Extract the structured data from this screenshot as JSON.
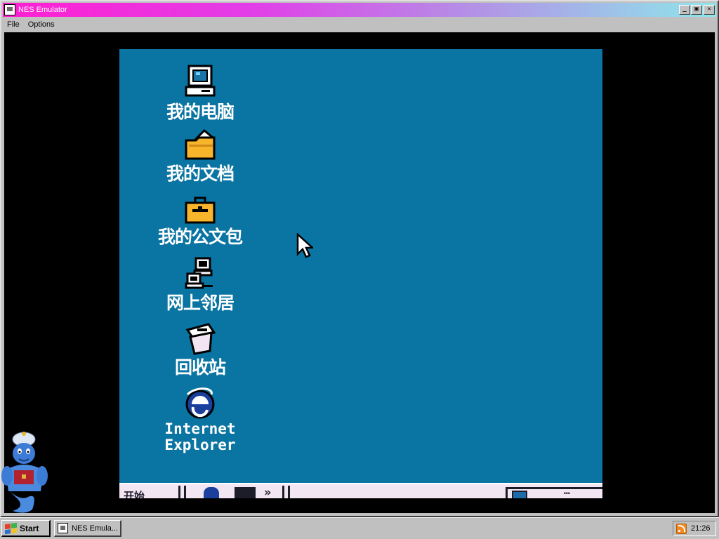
{
  "window": {
    "title": "NES Emulator",
    "buttons": [
      "minimize",
      "restore",
      "close"
    ]
  },
  "menu": [
    "File",
    "Options"
  ],
  "nes_desktop": {
    "background": "#0a74a2",
    "icons": [
      {
        "label": "我的电脑",
        "icon": "my-computer-icon"
      },
      {
        "label": "我的文档",
        "icon": "my-documents-icon"
      },
      {
        "label": "我的公文包",
        "icon": "briefcase-icon"
      },
      {
        "label": "网上邻居",
        "icon": "network-neighborhood-icon"
      },
      {
        "label": "回收站",
        "icon": "recycle-bin-icon"
      },
      {
        "label_line1": "Internet",
        "label_line2": "Explorer",
        "icon": "internet-explorer-icon"
      }
    ],
    "taskbar_fragment": "开始"
  },
  "taskbar": {
    "start_label": "Start",
    "task_button_label": "NES Emula...",
    "clock": "21:26"
  },
  "colors": {
    "title_gradient_start": "#ff1fd0",
    "title_gradient_end": "#8fe6ea",
    "chrome": "#c0c0c0"
  }
}
